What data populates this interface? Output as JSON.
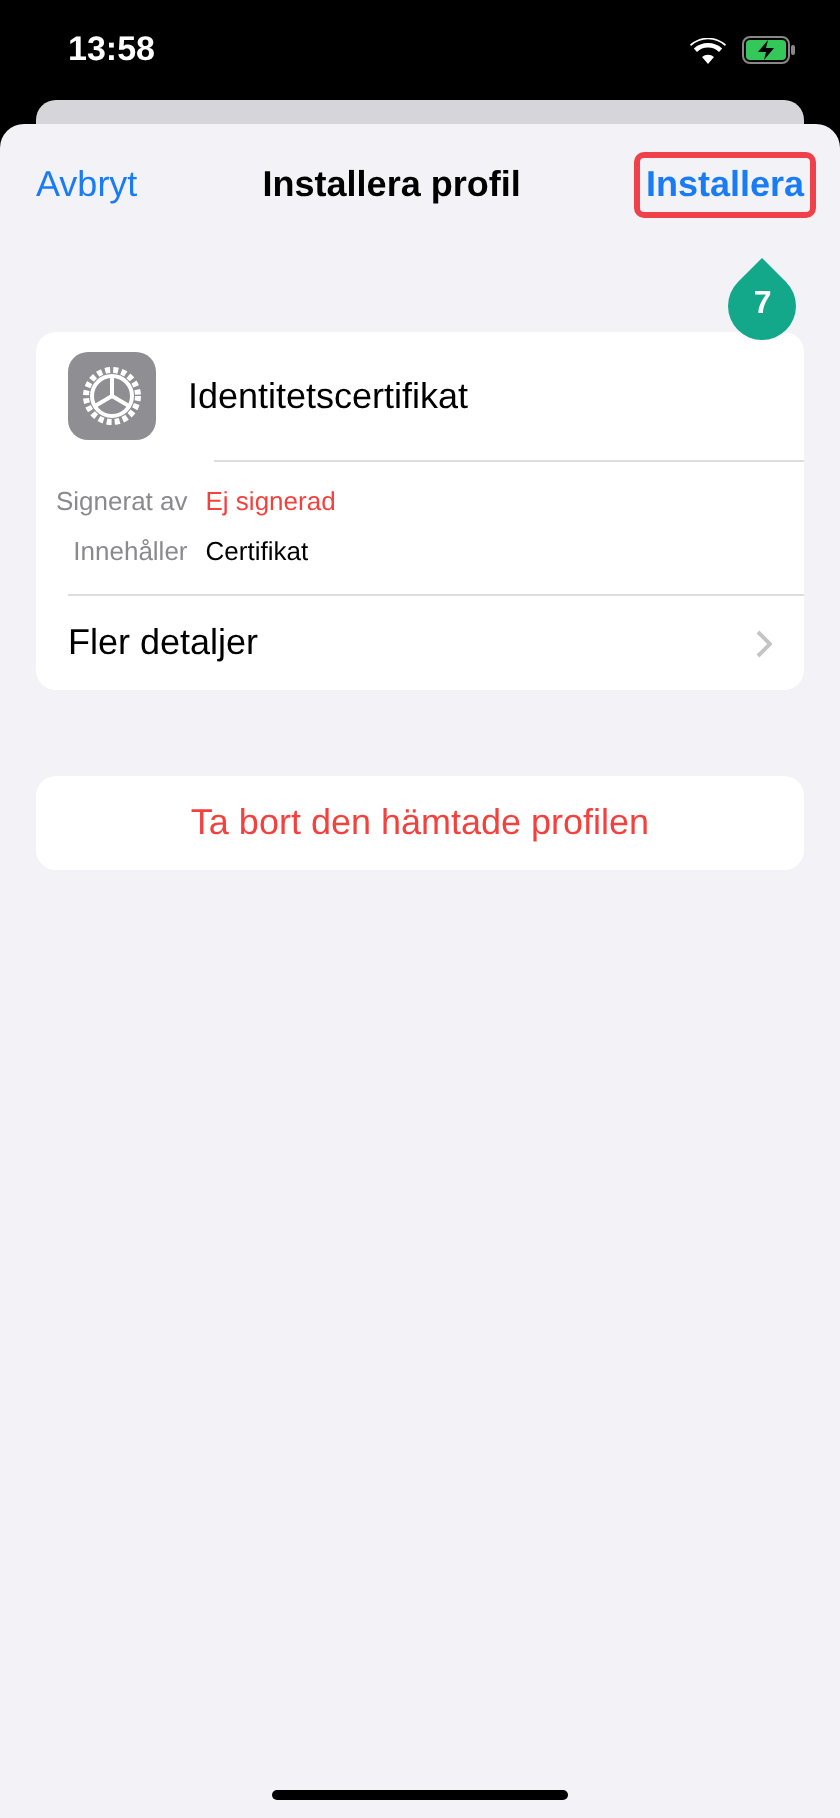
{
  "status_bar": {
    "time": "13:58"
  },
  "nav": {
    "cancel": "Avbryt",
    "title": "Installera profil",
    "install": {
      "label": "Installera",
      "highlighted": true
    }
  },
  "step_marker": {
    "label": "7"
  },
  "profile": {
    "name": "Identitetscertifikat",
    "details": [
      {
        "label": "Signerat av",
        "value": "Ej signerad",
        "alert": true
      },
      {
        "label": "Innehåller",
        "value": "Certifikat",
        "alert": false
      }
    ],
    "more": "Fler detaljer"
  },
  "remove_button": "Ta bort den hämtade profilen"
}
